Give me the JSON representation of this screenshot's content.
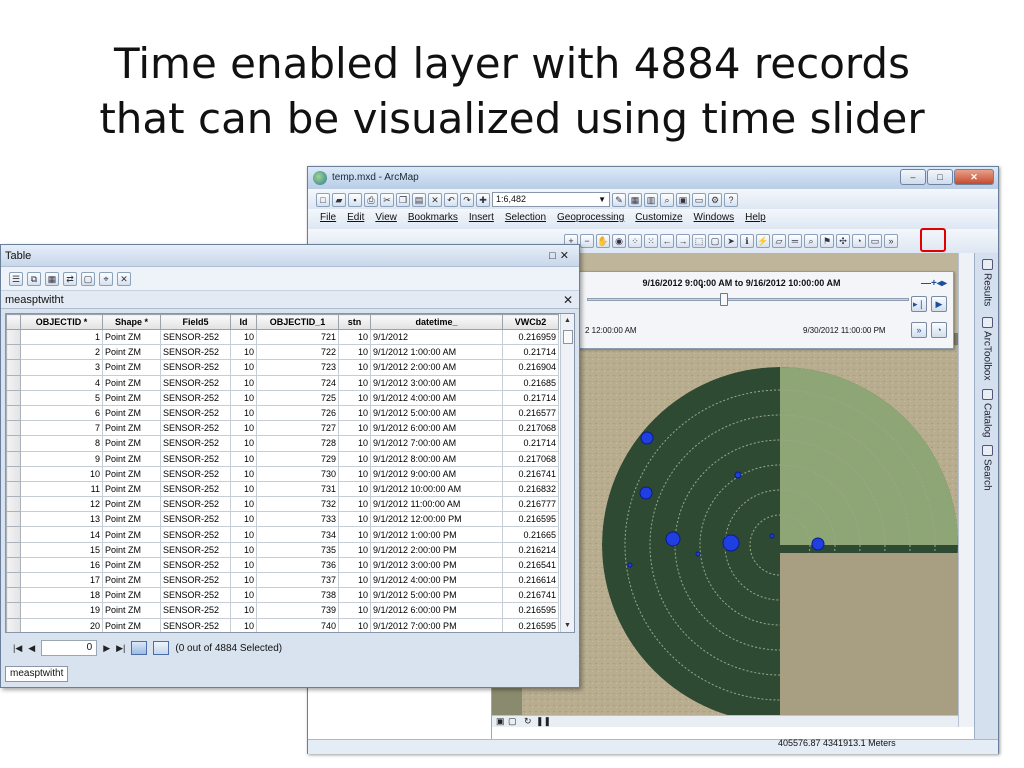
{
  "slide": {
    "title_line1": "Time enabled layer with 4884 records",
    "title_line2": "that can be visualized using time slider"
  },
  "arcmap": {
    "window_title": "temp.mxd - ArcMap",
    "scale": "1:6,482",
    "menu": [
      "File",
      "Edit",
      "View",
      "Bookmarks",
      "Insert",
      "Selection",
      "Geoprocessing",
      "Customize",
      "Windows",
      "Help"
    ],
    "side_tabs": [
      "Results",
      "ArcToolbox",
      "Catalog",
      "Search"
    ],
    "coordinates": "405576.87  4341913.1 Meters",
    "time_slider": {
      "current_range": "9/16/2012 9:00:00 AM to 9/16/2012 10:00:00 AM",
      "start_label": "2 12:00:00 AM",
      "end_label": "9/30/2012 11:00:00 PM",
      "position": 0.42
    }
  },
  "table_window": {
    "title": "Table",
    "tab_name": "measptwitht",
    "bottom_tab": "measptwitht",
    "columns": [
      "",
      "OBJECTID *",
      "Shape *",
      "Field5",
      "Id",
      "OBJECTID_1",
      "stn",
      "datetime_",
      "VWCb2"
    ],
    "rows": [
      [
        "1",
        "Point ZM",
        "SENSOR-252",
        "10",
        "721",
        "10",
        "9/1/2012",
        "0.216959"
      ],
      [
        "2",
        "Point ZM",
        "SENSOR-252",
        "10",
        "722",
        "10",
        "9/1/2012 1:00:00 AM",
        "0.21714"
      ],
      [
        "3",
        "Point ZM",
        "SENSOR-252",
        "10",
        "723",
        "10",
        "9/1/2012 2:00:00 AM",
        "0.216904"
      ],
      [
        "4",
        "Point ZM",
        "SENSOR-252",
        "10",
        "724",
        "10",
        "9/1/2012 3:00:00 AM",
        "0.21685"
      ],
      [
        "5",
        "Point ZM",
        "SENSOR-252",
        "10",
        "725",
        "10",
        "9/1/2012 4:00:00 AM",
        "0.21714"
      ],
      [
        "6",
        "Point ZM",
        "SENSOR-252",
        "10",
        "726",
        "10",
        "9/1/2012 5:00:00 AM",
        "0.216577"
      ],
      [
        "7",
        "Point ZM",
        "SENSOR-252",
        "10",
        "727",
        "10",
        "9/1/2012 6:00:00 AM",
        "0.217068"
      ],
      [
        "8",
        "Point ZM",
        "SENSOR-252",
        "10",
        "728",
        "10",
        "9/1/2012 7:00:00 AM",
        "0.21714"
      ],
      [
        "9",
        "Point ZM",
        "SENSOR-252",
        "10",
        "729",
        "10",
        "9/1/2012 8:00:00 AM",
        "0.217068"
      ],
      [
        "10",
        "Point ZM",
        "SENSOR-252",
        "10",
        "730",
        "10",
        "9/1/2012 9:00:00 AM",
        "0.216741"
      ],
      [
        "11",
        "Point ZM",
        "SENSOR-252",
        "10",
        "731",
        "10",
        "9/1/2012 10:00:00 AM",
        "0.216832"
      ],
      [
        "12",
        "Point ZM",
        "SENSOR-252",
        "10",
        "732",
        "10",
        "9/1/2012 11:00:00 AM",
        "0.216777"
      ],
      [
        "13",
        "Point ZM",
        "SENSOR-252",
        "10",
        "733",
        "10",
        "9/1/2012 12:00:00 PM",
        "0.216595"
      ],
      [
        "14",
        "Point ZM",
        "SENSOR-252",
        "10",
        "734",
        "10",
        "9/1/2012 1:00:00 PM",
        "0.21665"
      ],
      [
        "15",
        "Point ZM",
        "SENSOR-252",
        "10",
        "735",
        "10",
        "9/1/2012 2:00:00 PM",
        "0.216214"
      ],
      [
        "16",
        "Point ZM",
        "SENSOR-252",
        "10",
        "736",
        "10",
        "9/1/2012 3:00:00 PM",
        "0.216541"
      ],
      [
        "17",
        "Point ZM",
        "SENSOR-252",
        "10",
        "737",
        "10",
        "9/1/2012 4:00:00 PM",
        "0.216614"
      ],
      [
        "18",
        "Point ZM",
        "SENSOR-252",
        "10",
        "738",
        "10",
        "9/1/2012 5:00:00 PM",
        "0.216741"
      ],
      [
        "19",
        "Point ZM",
        "SENSOR-252",
        "10",
        "739",
        "10",
        "9/1/2012 6:00:00 PM",
        "0.216595"
      ],
      [
        "20",
        "Point ZM",
        "SENSOR-252",
        "10",
        "740",
        "10",
        "9/1/2012 7:00:00 PM",
        "0.216595"
      ]
    ],
    "current_record": "0",
    "selection_status": "(0 out of 4884 Selected)"
  },
  "colors": {
    "map_point": "#1f3fe0",
    "highlight": "#e00000",
    "field_dark": "#2e4a30"
  }
}
